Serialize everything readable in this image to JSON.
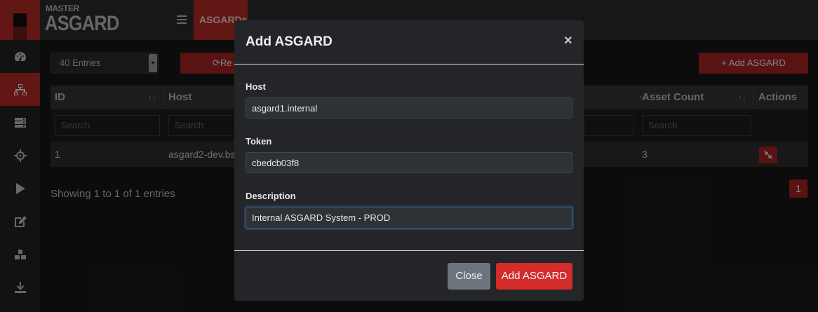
{
  "brand": {
    "small": "MASTER",
    "big": "ASGARD"
  },
  "topbar": {
    "active_tab": "ASGARDs"
  },
  "sidebar": {
    "items": [
      {
        "icon": "dashboard-icon"
      },
      {
        "icon": "network-icon",
        "active": true
      },
      {
        "icon": "server-icon"
      },
      {
        "icon": "crosshair-icon"
      },
      {
        "icon": "play-icon"
      },
      {
        "icon": "edit-icon"
      },
      {
        "icon": "boxes-icon"
      },
      {
        "icon": "download-icon"
      }
    ]
  },
  "toolbar": {
    "entries_select": "40 Entries",
    "reload_label": "Re",
    "add_label": "Add ASGARD"
  },
  "table": {
    "columns": [
      "ID",
      "Host",
      "Asset Count",
      "Actions"
    ],
    "filter_placeholder": "Search",
    "rows": [
      {
        "id": "1",
        "host": "asgard2-dev.bs",
        "asset_count": "3"
      }
    ]
  },
  "footer": {
    "showing": "Showing 1 to 1 of 1 entries",
    "page": "1"
  },
  "modal": {
    "title": "Add ASGARD",
    "close_icon": "×",
    "host_label": "Host",
    "host_value": "asgard1.internal",
    "token_label": "Token",
    "token_value": "cbedcb03f8",
    "description_label": "Description",
    "description_value": "Internal ASGARD System - PROD",
    "close_button": "Close",
    "submit_button": "Add ASGARD"
  },
  "colors": {
    "accent": "#b52a27",
    "submit": "#d42b2b",
    "secondary": "#6c757d"
  }
}
